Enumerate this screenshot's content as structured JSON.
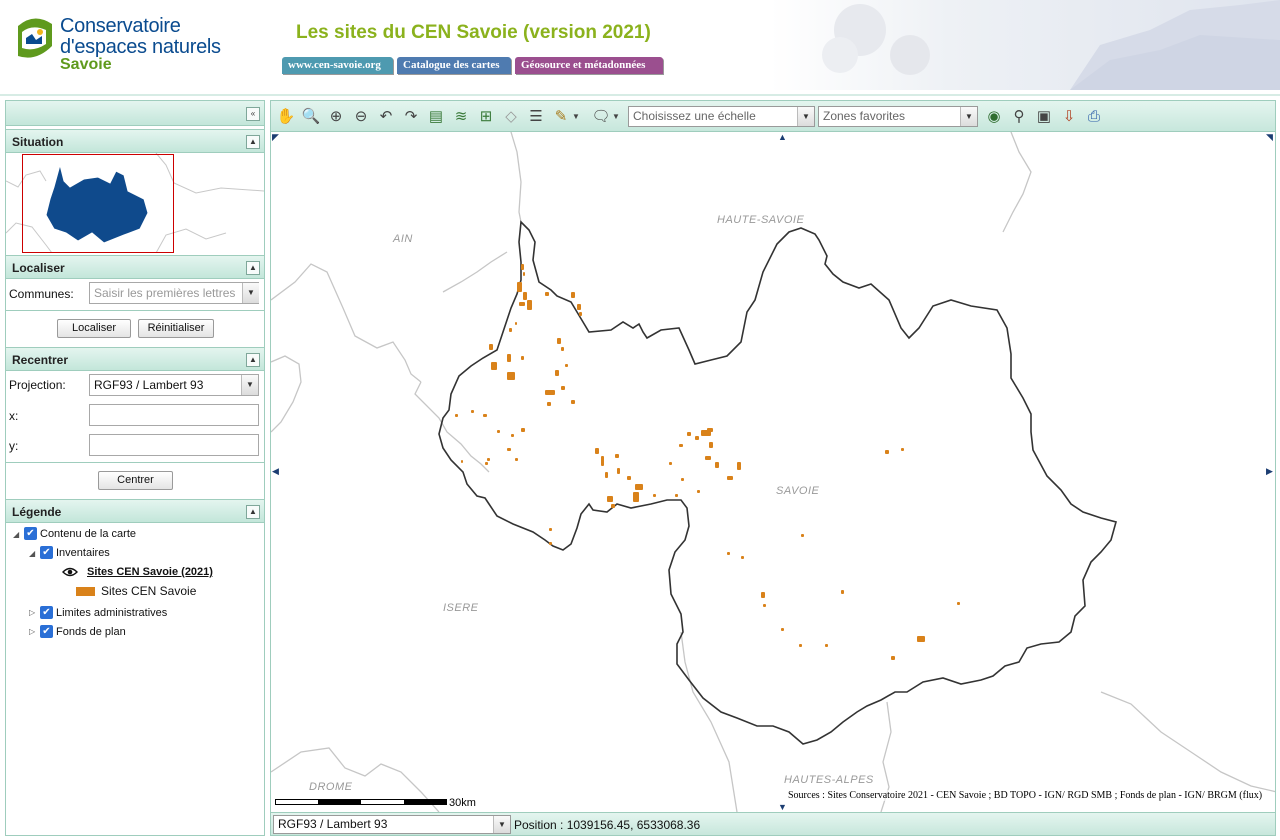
{
  "header": {
    "logo_lines": [
      "Conservatoire",
      "d'espaces naturels",
      "Savoie"
    ],
    "title": "Les sites du CEN Savoie (version 2021)",
    "links": [
      "www.cen-savoie.org",
      "Catalogue des cartes",
      "Géosource et métadonnées"
    ]
  },
  "sidebar": {
    "collapse_icon": "double-chevron-left-icon",
    "situation": {
      "title": "Situation"
    },
    "localiser": {
      "title": "Localiser",
      "communes_label": "Communes:",
      "communes_placeholder": "Saisir les premières lettres",
      "localiser_button": "Localiser",
      "reset_button": "Réinitialiser"
    },
    "recentrer": {
      "title": "Recentrer",
      "projection_label": "Projection:",
      "projection_value": "RGF93 / Lambert 93",
      "x_label": "x:",
      "y_label": "y:",
      "x_value": "",
      "y_value": "",
      "center_button": "Centrer"
    },
    "legende": {
      "title": "Légende",
      "items": {
        "root": "Contenu de la carte",
        "inventaires": "Inventaires",
        "layer": "Sites CEN Savoie (2021)",
        "symbol_label": "Sites CEN Savoie",
        "limites": "Limites administratives",
        "fonds": "Fonds de plan"
      },
      "symbol_color": "#d9821a"
    }
  },
  "toolbar": {
    "tools": [
      "pan-hand-icon",
      "zoom-extent-icon",
      "zoom-in-icon",
      "zoom-out-icon",
      "previous-view-icon",
      "next-view-icon",
      "add-layer-icon",
      "layers-icon",
      "wfs-layer-icon",
      "layer-off-icon",
      "list-icon",
      "measure-icon",
      "comment-icon"
    ],
    "scale_placeholder": "Choisissez une échelle",
    "zones_placeholder": "Zones favorites",
    "right_tools": [
      "globe-icon",
      "binoculars-icon",
      "save-icon",
      "download-icon",
      "print-icon"
    ]
  },
  "map": {
    "departments": [
      "AIN",
      "HAUTE-SAVOIE",
      "SAVOIE",
      "ISERE",
      "DROME",
      "HAUTES-ALPES"
    ],
    "scale_label": "30km",
    "sources": "Sources : Sites Conservatoire 2021 - CEN Savoie ; BD TOPO - IGN/ RGD SMB ; Fonds de plan - IGN/ BRGM (flux)",
    "site_color": "#d9821a"
  },
  "statusbar": {
    "projection": "RGF93 / Lambert 93",
    "position": "Position : 1039156.45, 6533068.36"
  }
}
